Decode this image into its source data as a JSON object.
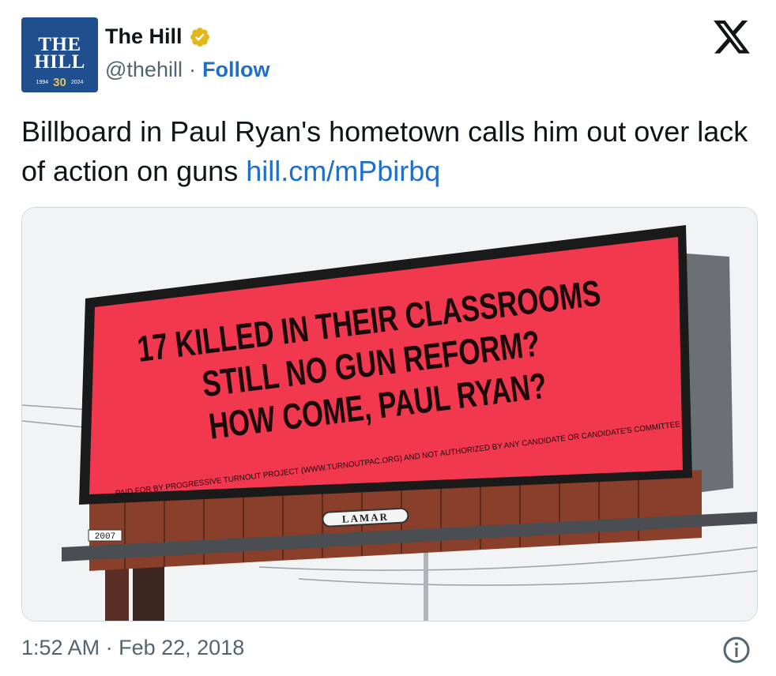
{
  "author": {
    "display_name": "The Hill",
    "handle": "@thehill",
    "separator": "·",
    "follow_label": "Follow",
    "avatar": {
      "line1": "THE",
      "line2": "HILL",
      "year_start": "1994",
      "anniversary": "30",
      "year_end": "2024"
    }
  },
  "tweet": {
    "text": "Billboard in Paul Ryan's hometown calls him out over lack of action on guns",
    "link": "hill.cm/mPbirbq"
  },
  "billboard": {
    "line1": "17 KILLED IN THEIR CLASSROOMS",
    "line2": "STILL NO GUN REFORM?",
    "line3": "HOW COME, PAUL RYAN?",
    "disclaimer": "PAID FOR BY PROGRESSIVE TURNOUT PROJECT (WWW.TURNOUTPAC.ORG) AND NOT AUTHORIZED BY ANY CANDIDATE OR CANDIDATE'S COMMITTEE",
    "brand": "LAMAR",
    "number": "2007"
  },
  "footer": {
    "time": "1:52 AM",
    "separator": "·",
    "date": "Feb 22, 2018"
  },
  "colors": {
    "link": "#1d6fc8",
    "verified": "#e2b719",
    "billboard_red": "#f2384f",
    "avatar_bg": "#1f4f8e"
  },
  "icons": [
    "verified-badge-icon",
    "x-logo-icon",
    "info-icon"
  ]
}
